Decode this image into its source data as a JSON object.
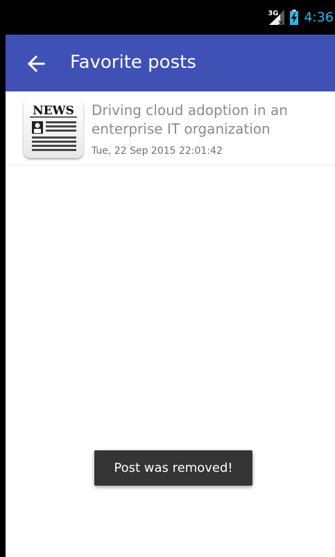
{
  "status_bar": {
    "network_type": "3G",
    "time": "4:36",
    "icons": [
      "signal-icon",
      "battery-charging-icon"
    ],
    "clock_color": "#33b5e5"
  },
  "app_bar": {
    "title": "Favorite posts",
    "back_icon": "arrow-back-icon",
    "color": "#3f51b5"
  },
  "posts": [
    {
      "title": "Driving cloud adoption in an enterprise IT organization",
      "date": "Tue, 22 Sep 2015 22:01:42",
      "thumbnail": {
        "icon": "news-icon",
        "label": "NEWS"
      }
    }
  ],
  "toast": {
    "message": "Post was removed!"
  }
}
